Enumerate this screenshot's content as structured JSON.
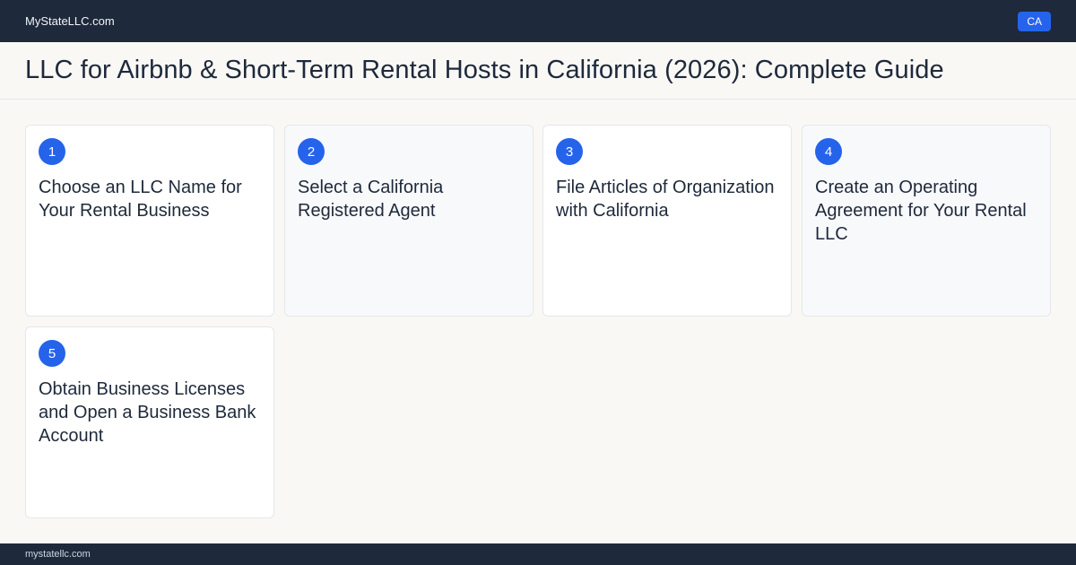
{
  "header": {
    "brand": "MyStateLLC.com",
    "state_badge": "CA"
  },
  "page": {
    "title": "LLC for Airbnb & Short-Term Rental Hosts in California (2026): Complete Guide"
  },
  "steps": [
    {
      "number": "1",
      "title": "Choose an LLC Name for Your Rental Business"
    },
    {
      "number": "2",
      "title": "Select a California Registered Agent"
    },
    {
      "number": "3",
      "title": "File Articles of Organization with California"
    },
    {
      "number": "4",
      "title": "Create an Operating Agreement for Your Rental LLC"
    },
    {
      "number": "5",
      "title": "Obtain Business Licenses and Open a Business Bank Account"
    }
  ],
  "footer": {
    "domain": "mystatellc.com"
  },
  "colors": {
    "navy": "#1e293b",
    "accent_blue": "#2563eb",
    "page_background": "#f9f8f5"
  }
}
